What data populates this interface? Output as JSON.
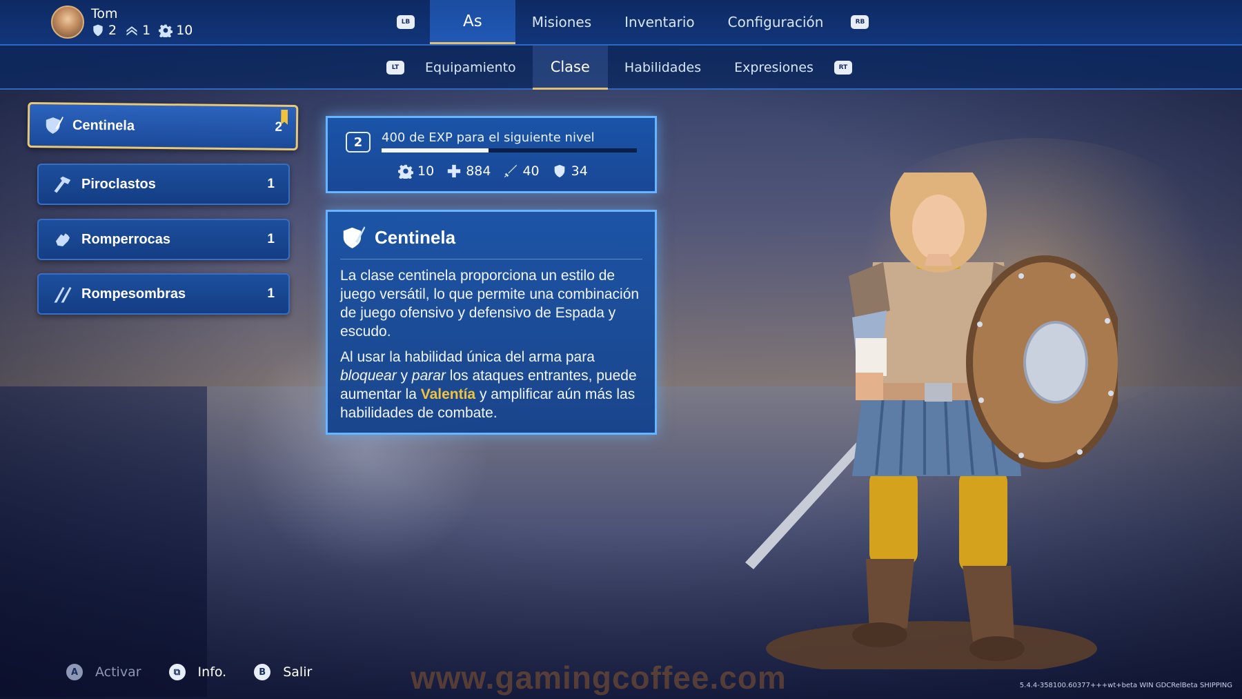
{
  "player": {
    "name": "Tom",
    "stats": [
      {
        "icon": "shield-icon",
        "value": "2"
      },
      {
        "icon": "chevron-rank-icon",
        "value": "1"
      },
      {
        "icon": "gear-icon",
        "value": "10"
      }
    ]
  },
  "topnav": {
    "lb": "LB",
    "rb": "RB",
    "tabs": [
      "As",
      "Misiones",
      "Inventario",
      "Configuración"
    ],
    "active": "As"
  },
  "subnav": {
    "lt": "LT",
    "rt": "RT",
    "tabs": [
      "Equipamiento",
      "Clase",
      "Habilidades",
      "Expresiones"
    ],
    "active": "Clase"
  },
  "classes": [
    {
      "name": "Centinela",
      "level": "2",
      "icon": "shield-sword-icon",
      "selected": true
    },
    {
      "name": "Piroclastos",
      "level": "1",
      "icon": "hammer-icon"
    },
    {
      "name": "Romperrocas",
      "level": "1",
      "icon": "gauntlet-icon"
    },
    {
      "name": "Rompesombras",
      "level": "1",
      "icon": "daggers-icon"
    }
  ],
  "exp": {
    "level": "2",
    "text": "400 de EXP para el siguiente nivel",
    "progress": 0.42,
    "stats": [
      {
        "icon": "gear-icon",
        "value": "10"
      },
      {
        "icon": "health-icon",
        "value": "884"
      },
      {
        "icon": "sword-icon",
        "value": "40"
      },
      {
        "icon": "shield-icon",
        "value": "34"
      }
    ]
  },
  "description": {
    "title": "Centinela",
    "p1": "La clase centinela proporciona un estilo de juego versátil, lo que permite una combinación de juego ofensivo y defensivo de Espada y escudo.",
    "p2_a": "Al usar la habilidad única del arma para ",
    "p2_em1": "bloquear",
    "p2_b": " y ",
    "p2_em2": "parar",
    "p2_c": " los ataques entrantes, puede aumentar la ",
    "p2_highlight": "Valentía",
    "p2_d": " y amplificar aún más las habilidades de combate."
  },
  "hints": [
    {
      "button": "A",
      "label": "Activar",
      "dim": true
    },
    {
      "button": "⧉",
      "label": "Info.",
      "dim": false
    },
    {
      "button": "B",
      "label": "Salir",
      "dim": false
    }
  ],
  "watermark": "www.gamingcoffee.com",
  "version": "5.4.4-358100.60377+++wt+beta WIN GDCRelBeta SHIPPING",
  "colors": {
    "accent_gold": "#e9c979",
    "panel_blue": "#1a54a8",
    "glow": "#6ab4ff",
    "highlight": "#f2c23c"
  }
}
